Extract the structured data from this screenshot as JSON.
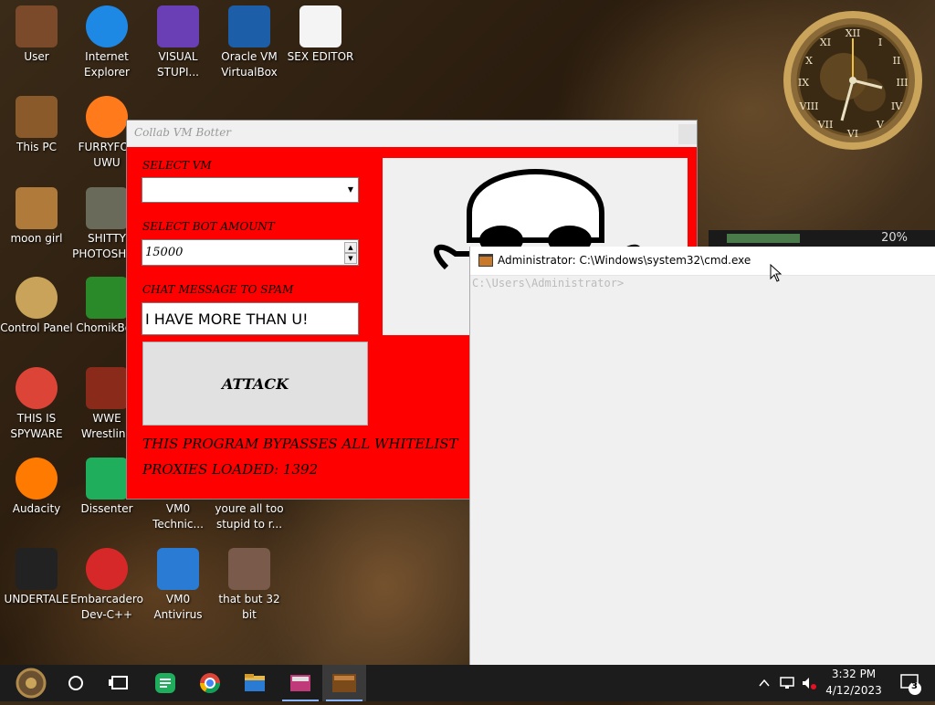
{
  "desktop_icons": [
    {
      "label": "User",
      "icon": "user-folder-icon"
    },
    {
      "label": "Internet Explorer",
      "icon": "edge-icon"
    },
    {
      "label": "VISUAL STUPI...",
      "icon": "visual-studio-icon"
    },
    {
      "label": "Oracle VM VirtualBox",
      "icon": "virtualbox-icon"
    },
    {
      "label": "SEX EDITOR",
      "icon": "hex-editor-icon"
    },
    {
      "label": "This PC",
      "icon": "this-pc-icon"
    },
    {
      "label": "FURRYFOX UWU",
      "icon": "firefox-icon"
    },
    {
      "label": "moon girl",
      "icon": "moon-girl-icon"
    },
    {
      "label": "SHITTY PHOTOSHOP",
      "icon": "gimp-icon"
    },
    {
      "label": "Control Panel",
      "icon": "control-panel-icon"
    },
    {
      "label": "ChomikBox",
      "icon": "chomikbox-icon"
    },
    {
      "label": "THIS IS SPYWARE",
      "icon": "chrome-icon"
    },
    {
      "label": "WWE Wrestling",
      "icon": "wwe-icon"
    },
    {
      "label": "Audacity",
      "icon": "audacity-icon"
    },
    {
      "label": "Dissenter",
      "icon": "dissenter-icon"
    },
    {
      "label": "VM0 Technic...",
      "icon": "vm0-technic-icon"
    },
    {
      "label": "youre all too stupid to r...",
      "icon": "document-icon"
    },
    {
      "label": "UNDERTALE",
      "icon": "unity-icon"
    },
    {
      "label": "Embarcadero Dev-C++",
      "icon": "devcpp-icon"
    },
    {
      "label": "VM0 Antivirus",
      "icon": "shield-icon"
    },
    {
      "label": "that but 32 bit",
      "icon": "portrait-icon"
    }
  ],
  "botter": {
    "title": "Collab VM Botter",
    "select_vm_label": "SELECT VM",
    "select_vm_value": "",
    "bot_amount_label": "SELECT BOT AMOUNT",
    "bot_amount_value": "15000",
    "chat_label": "CHAT MESSAGE TO SPAM",
    "chat_value": "I HAVE MORE THAN U!",
    "attack_label": "ATTACK",
    "bypass_text": "THIS PROGRAM BYPASSES ALL WHITELIST",
    "proxies_text": "PROXIES LOADED: 1392"
  },
  "cmd": {
    "title": "Administrator: C:\\Windows\\system32\\cmd.exe",
    "prompt": "C:\\Users\\Administrator>"
  },
  "widget": {
    "percent": "20%"
  },
  "taskbar": {
    "time": "3:32 PM",
    "date": "4/12/2023",
    "notification_count": "3"
  },
  "colors": {
    "botter_bg": "#ff0000",
    "taskbar_bg": "#1c1c1c"
  }
}
